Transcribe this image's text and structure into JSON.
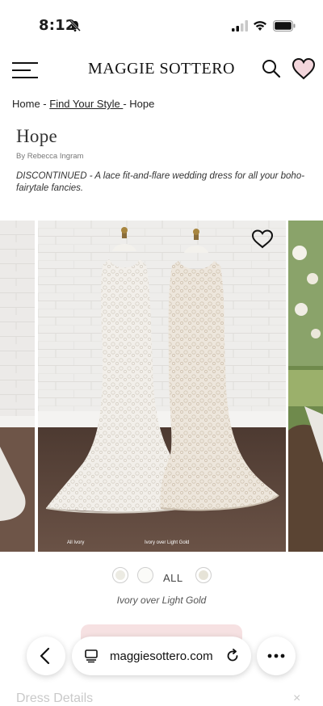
{
  "status": {
    "time": "8:12"
  },
  "header": {
    "logo": "MAGGIE SOTTERO"
  },
  "breadcrumb": {
    "home": "Home",
    "sep1": " - ",
    "find": "Find Your Style ",
    "sep2": "- ",
    "current": "Hope"
  },
  "product": {
    "title": "Hope",
    "designer": "By Rebecca Ingram",
    "description": "DISCONTINUED - A lace fit-and-flare wedding dress for all your boho-fairytale fancies."
  },
  "gallery": {
    "captions": [
      "All Ivory",
      "Ivory over Light Gold"
    ]
  },
  "colors": {
    "all_label": "ALL",
    "selected": "Ivory over Light Gold",
    "swatches": [
      "#ecebe3",
      "#fbfbf8",
      "#e6e3d7"
    ]
  },
  "browser": {
    "url": "maggiesottero.com"
  },
  "footer": {
    "dress_details": "Dress Details",
    "toggle": "×"
  },
  "theme": {
    "accent_pink": "#f6e1e2",
    "text": "#1d1d1d"
  }
}
